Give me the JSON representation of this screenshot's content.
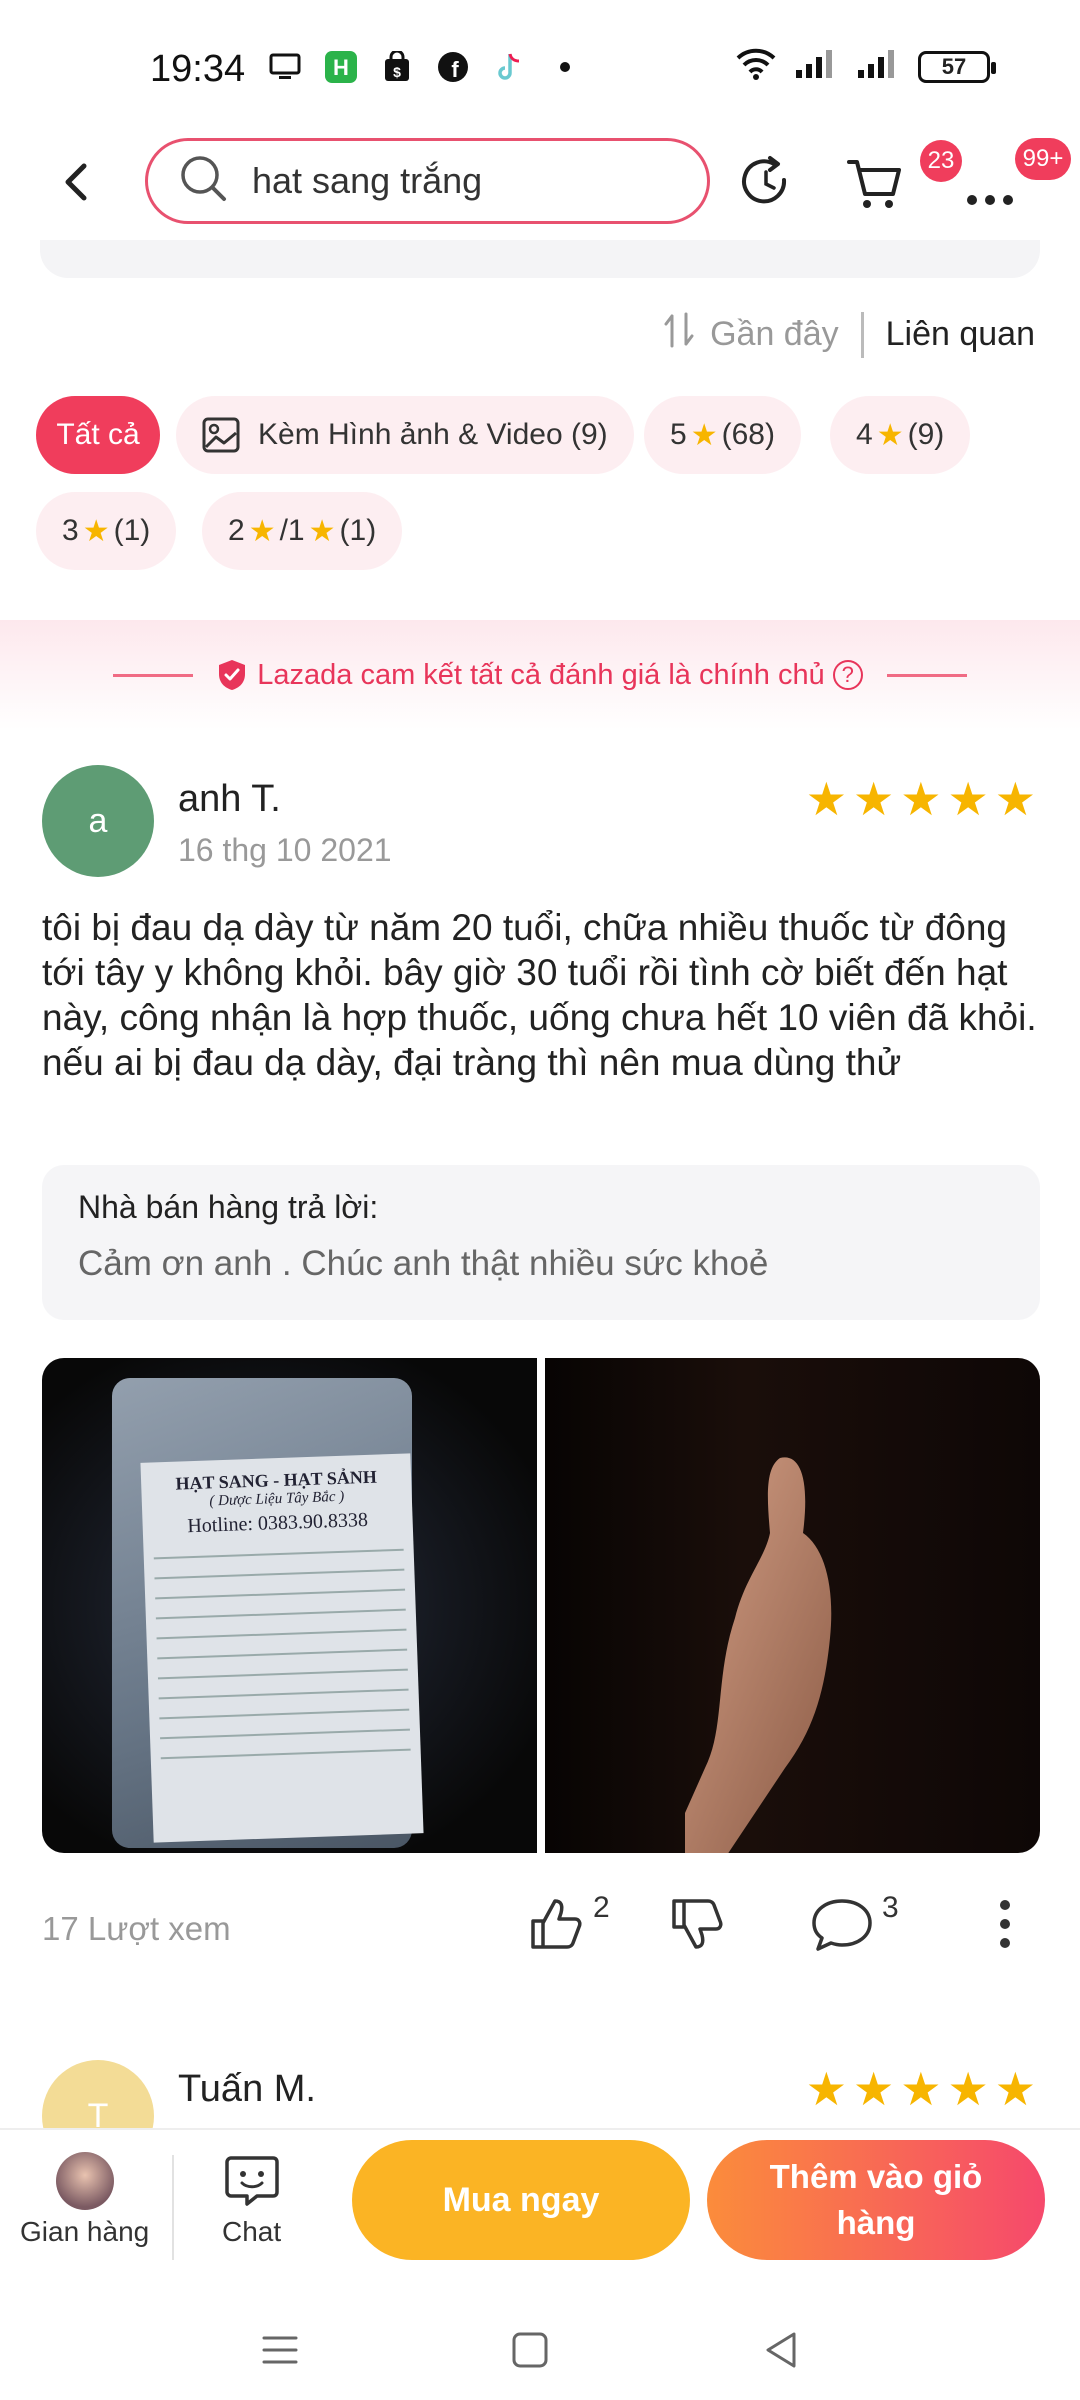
{
  "status_bar": {
    "time": "19:34",
    "battery": "57"
  },
  "header": {
    "search_value": "hat sang trắng",
    "cart_badge": "23",
    "more_badge": "99+"
  },
  "sort": {
    "recent": "Gần đây",
    "relevant": "Liên quan"
  },
  "filters": {
    "all": "Tất cả",
    "media": "Kèm Hình ảnh & Video (9)",
    "five_num": "5",
    "five_count": "(68)",
    "four_num": "4",
    "four_count": "(9)",
    "three_num": "3",
    "three_count": "(1)",
    "two_num": "2",
    "two_mid": "/1",
    "two_count": "(1)"
  },
  "guarantee": {
    "text": "Lazada cam kết tất cả đánh giá là chính chủ",
    "help": "?"
  },
  "reviews": [
    {
      "avatar_letter": "a",
      "avatar_color": "#5e9c74",
      "name": "anh T.",
      "date": "16 thg 10 2021",
      "rating": 5,
      "text": "tôi bị đau dạ dày từ năm 20 tuổi, chữa nhiều thuốc từ đông tới tây y không khỏi. bây giờ 30 tuổi rồi tình cờ biết đến hạt này, công nhận là hợp thuốc, uống chưa hết 10 viên đã khỏi. nếu ai bị đau dạ dày, đại tràng thì nên mua dùng thử",
      "seller_reply_label": "Nhà bán hàng trả lời:",
      "seller_reply": "Cảm ơn anh . Chúc anh thật nhiều sức khoẻ",
      "photo_label": {
        "title": "HẠT SANG - HẠT SẢNH",
        "subtitle": "( Dược Liệu Tây Bắc )",
        "hotline": "Hotline: 0383.90.8338"
      },
      "views": "17 Lượt xem",
      "likes": "2",
      "comments": "3"
    },
    {
      "avatar_letter": "T",
      "avatar_color": "#f3dc96",
      "name": "Tuấn M.",
      "rating": 5
    }
  ],
  "bottom_bar": {
    "shop_label": "Gian hàng",
    "chat_label": "Chat",
    "buy_now": "Mua ngay",
    "add_to_cart": "Thêm vào giỏ hàng"
  },
  "colors": {
    "accent": "#f03d5c",
    "star": "#f7b500",
    "buy": "#fbb424"
  },
  "icons": [
    "back-arrow-icon",
    "search-icon",
    "refresh-icon",
    "cart-icon",
    "more-icon",
    "sort-icon",
    "image-icon",
    "shield-check-icon",
    "thumbs-up-icon",
    "thumbs-down-icon",
    "comment-icon",
    "chat-icon",
    "menu-icon",
    "home-icon",
    "back-icon"
  ]
}
